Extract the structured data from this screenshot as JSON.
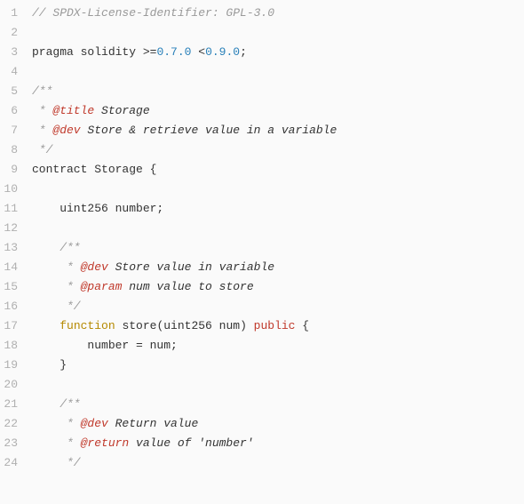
{
  "lines": [
    {
      "n": 1,
      "tokens": [
        {
          "t": "// SPDX-License-Identifier: GPL-3.0",
          "c": "tok-comment"
        }
      ]
    },
    {
      "n": 2,
      "tokens": [
        {
          "t": "",
          "c": "tok-default"
        }
      ]
    },
    {
      "n": 3,
      "tokens": [
        {
          "t": "pragma solidity >=",
          "c": "tok-keyword"
        },
        {
          "t": "0.7.0",
          "c": "tok-number"
        },
        {
          "t": " <",
          "c": "tok-keyword"
        },
        {
          "t": "0.9.0",
          "c": "tok-number"
        },
        {
          "t": ";",
          "c": "tok-keyword"
        }
      ]
    },
    {
      "n": 4,
      "tokens": [
        {
          "t": "",
          "c": "tok-default"
        }
      ]
    },
    {
      "n": 5,
      "tokens": [
        {
          "t": "/**",
          "c": "tok-comment"
        }
      ]
    },
    {
      "n": 6,
      "tokens": [
        {
          "t": " * ",
          "c": "tok-comment"
        },
        {
          "t": "@title",
          "c": "tok-tag"
        },
        {
          "t": " Storage",
          "c": "tok-ident"
        }
      ]
    },
    {
      "n": 7,
      "tokens": [
        {
          "t": " * ",
          "c": "tok-comment"
        },
        {
          "t": "@dev",
          "c": "tok-tag"
        },
        {
          "t": " Store & retrieve value in a variable",
          "c": "tok-ident"
        }
      ]
    },
    {
      "n": 8,
      "tokens": [
        {
          "t": " */",
          "c": "tok-comment"
        }
      ]
    },
    {
      "n": 9,
      "tokens": [
        {
          "t": "contract Storage {",
          "c": "tok-keyword"
        }
      ]
    },
    {
      "n": 10,
      "tokens": [
        {
          "t": "",
          "c": "tok-default"
        }
      ]
    },
    {
      "n": 11,
      "tokens": [
        {
          "t": "    uint256 number;",
          "c": "tok-keyword"
        }
      ]
    },
    {
      "n": 12,
      "tokens": [
        {
          "t": "",
          "c": "tok-default"
        }
      ]
    },
    {
      "n": 13,
      "tokens": [
        {
          "t": "    /**",
          "c": "tok-comment"
        }
      ]
    },
    {
      "n": 14,
      "tokens": [
        {
          "t": "     * ",
          "c": "tok-comment"
        },
        {
          "t": "@dev",
          "c": "tok-tag"
        },
        {
          "t": " Store value in variable",
          "c": "tok-ident"
        }
      ]
    },
    {
      "n": 15,
      "tokens": [
        {
          "t": "     * ",
          "c": "tok-comment"
        },
        {
          "t": "@param",
          "c": "tok-tag"
        },
        {
          "t": " num value to store",
          "c": "tok-ident"
        }
      ]
    },
    {
      "n": 16,
      "tokens": [
        {
          "t": "     */",
          "c": "tok-comment"
        }
      ]
    },
    {
      "n": 17,
      "tokens": [
        {
          "t": "    ",
          "c": "tok-default"
        },
        {
          "t": "function",
          "c": "tok-func"
        },
        {
          "t": " store(uint256 num) ",
          "c": "tok-keyword"
        },
        {
          "t": "public",
          "c": "tok-modifier"
        },
        {
          "t": " {",
          "c": "tok-keyword"
        }
      ]
    },
    {
      "n": 18,
      "tokens": [
        {
          "t": "        number = num;",
          "c": "tok-keyword"
        }
      ]
    },
    {
      "n": 19,
      "tokens": [
        {
          "t": "    }",
          "c": "tok-keyword"
        }
      ]
    },
    {
      "n": 20,
      "tokens": [
        {
          "t": "",
          "c": "tok-default"
        }
      ]
    },
    {
      "n": 21,
      "tokens": [
        {
          "t": "    /**",
          "c": "tok-comment"
        }
      ]
    },
    {
      "n": 22,
      "tokens": [
        {
          "t": "     * ",
          "c": "tok-comment"
        },
        {
          "t": "@dev",
          "c": "tok-tag"
        },
        {
          "t": " Return value",
          "c": "tok-ident"
        }
      ]
    },
    {
      "n": 23,
      "tokens": [
        {
          "t": "     * ",
          "c": "tok-comment"
        },
        {
          "t": "@return",
          "c": "tok-tag"
        },
        {
          "t": " value of 'number'",
          "c": "tok-ident"
        }
      ]
    },
    {
      "n": 24,
      "tokens": [
        {
          "t": "     */",
          "c": "tok-comment"
        }
      ]
    }
  ],
  "watermark": ""
}
